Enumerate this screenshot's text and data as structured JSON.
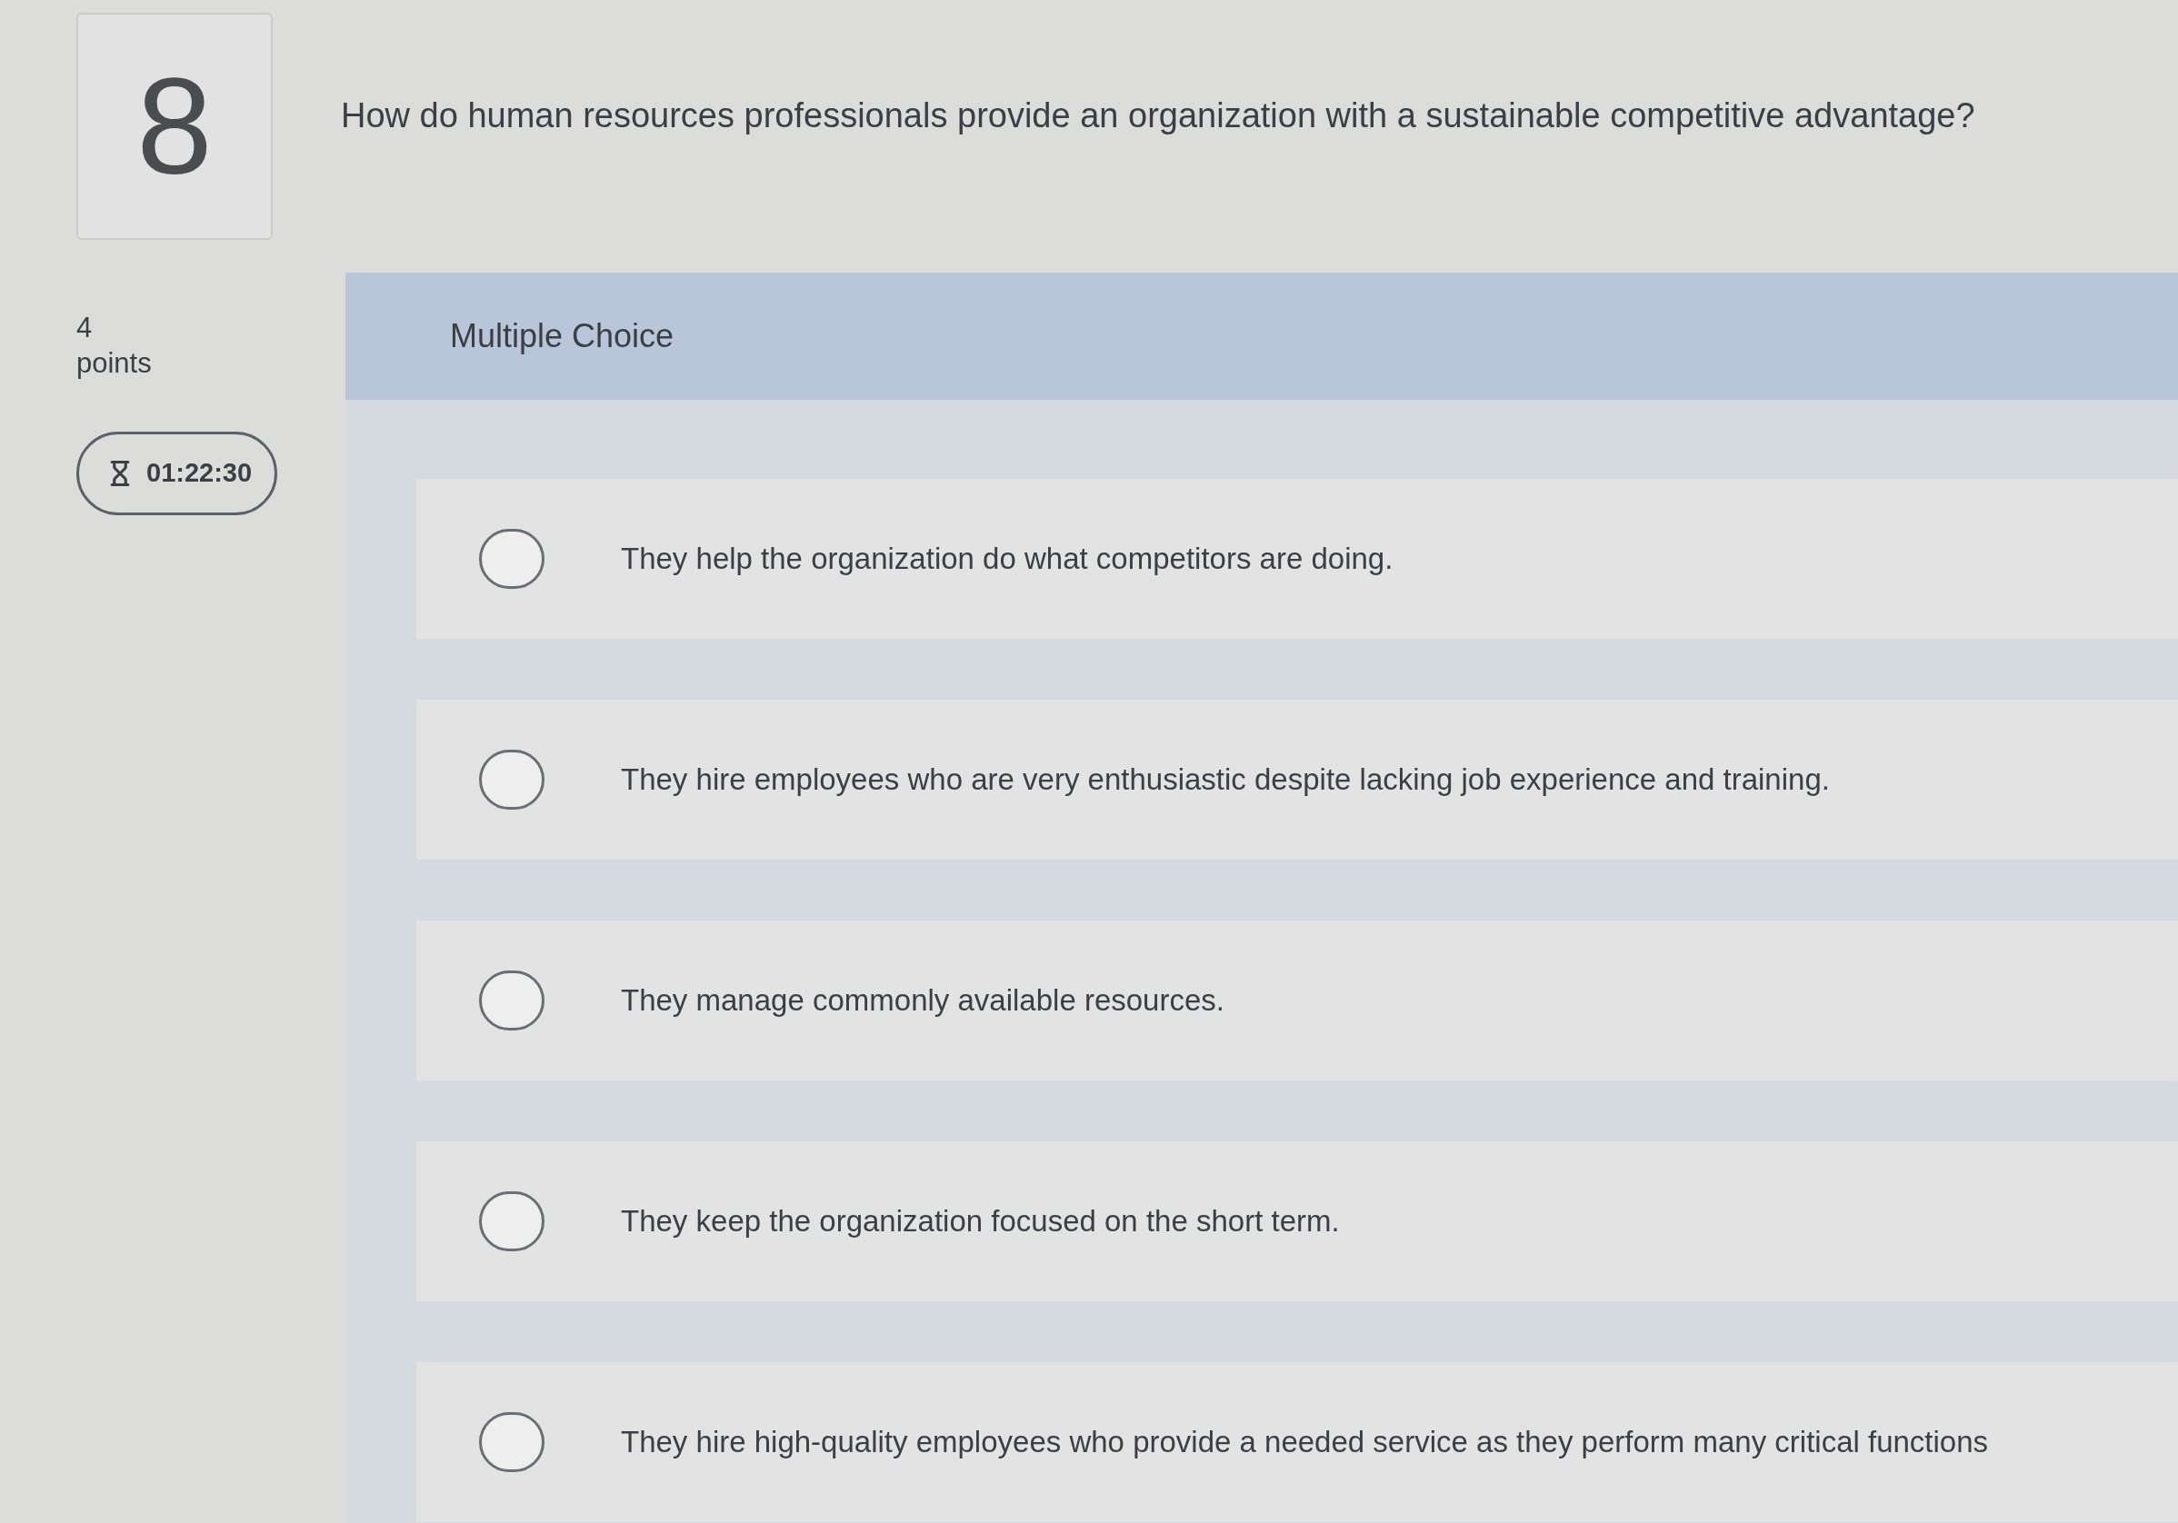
{
  "question": {
    "number": "8",
    "text": "How do human resources professionals provide an organization with a sustainable competitive advantage?",
    "points": "4",
    "points_label": "points",
    "timer": "01:22:30",
    "type_label": "Multiple Choice"
  },
  "options": [
    {
      "text": "They help the organization do what competitors are doing.",
      "selected": false
    },
    {
      "text": "They hire employees who are very enthusiastic despite lacking job experience and training.",
      "selected": false
    },
    {
      "text": "They manage commonly available resources.",
      "selected": false
    },
    {
      "text": "They keep the organization focused on the short term.",
      "selected": false
    },
    {
      "text": "They hire high-quality employees who provide a needed service as they perform many critical functions",
      "selected": false
    }
  ]
}
